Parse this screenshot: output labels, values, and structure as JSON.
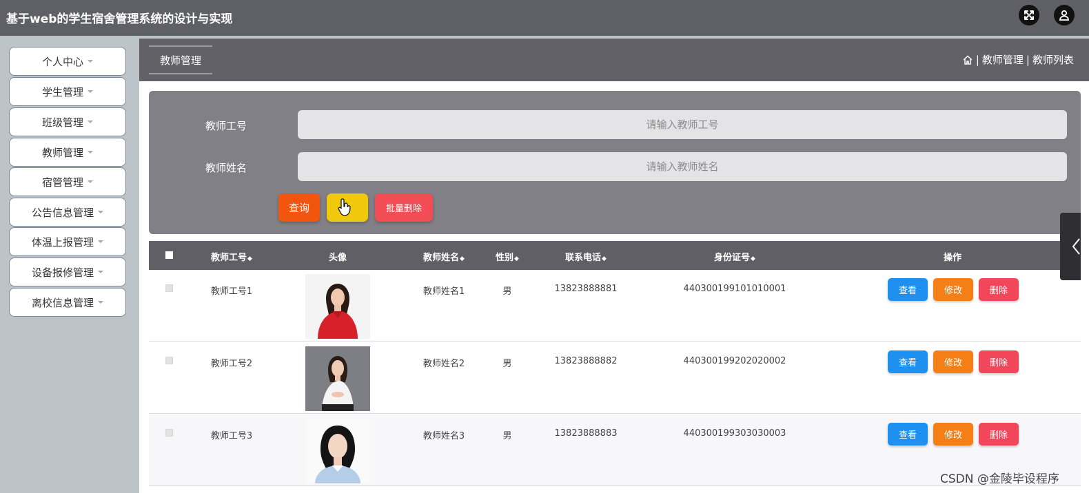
{
  "app": {
    "title": "基于web的学生宿舍管理系统的设计与实现"
  },
  "header_icons": {
    "fullscreen": "fullscreen-icon",
    "user": "user-icon"
  },
  "sidebar": {
    "items": [
      {
        "label": "个人中心"
      },
      {
        "label": "学生管理"
      },
      {
        "label": "班级管理"
      },
      {
        "label": "教师管理"
      },
      {
        "label": "宿管管理"
      },
      {
        "label": "公告信息管理"
      },
      {
        "label": "体温上报管理"
      },
      {
        "label": "设备报修管理"
      },
      {
        "label": "离校信息管理"
      }
    ]
  },
  "page": {
    "tab": "教师管理",
    "breadcrumb": [
      "|",
      "教师管理",
      "|",
      "教师列表"
    ]
  },
  "search": {
    "fields": [
      {
        "label": "教师工号",
        "placeholder": "请输入教师工号",
        "value": ""
      },
      {
        "label": "教师姓名",
        "placeholder": "请输入教师姓名",
        "value": ""
      }
    ],
    "buttons": {
      "query": "查询",
      "add": "",
      "batch_delete": "批量删除"
    }
  },
  "table": {
    "headers": {
      "id": "教师工号",
      "avatar": "头像",
      "name": "教师姓名",
      "gender": "性别",
      "phone": "联系电话",
      "idcard": "身份证号",
      "actions": "操作"
    },
    "sort_glyph": "◆",
    "rows": [
      {
        "id": "教师工号1",
        "name": "教师姓名1",
        "gender": "男",
        "phone": "13823888881",
        "idcard": "440300199101010001",
        "view": "查看",
        "edit": "修改",
        "del": "删除"
      },
      {
        "id": "教师工号2",
        "name": "教师姓名2",
        "gender": "男",
        "phone": "13823888882",
        "idcard": "440300199202020002",
        "view": "查看",
        "edit": "修改",
        "del": "删除"
      },
      {
        "id": "教师工号3",
        "name": "教师姓名3",
        "gender": "男",
        "phone": "13823888883",
        "idcard": "440300199303030003",
        "view": "查看",
        "edit": "修改",
        "del": "删除"
      }
    ]
  },
  "watermark": "CSDN @金陵毕设程序",
  "colors": {
    "header_bg": "#5f5f66",
    "query": "#f2550e",
    "add": "#f0c80c",
    "batch_delete": "#f24d54",
    "view": "#1e90f0",
    "edit": "#f57f17",
    "delete": "#f2475a"
  }
}
